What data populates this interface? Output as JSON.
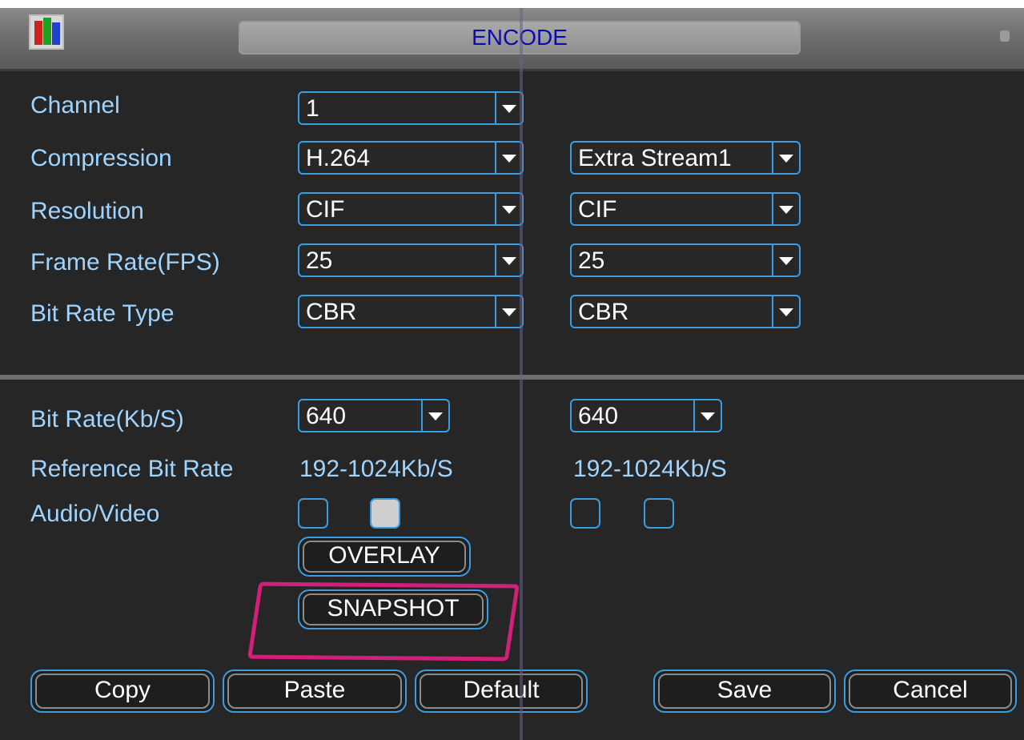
{
  "title": "ENCODE",
  "labels": {
    "channel": "Channel",
    "compression": "Compression",
    "resolution": "Resolution",
    "frame_rate": "Frame Rate(FPS)",
    "bit_rate_type": "Bit Rate Type",
    "bit_rate": "Bit Rate(Kb/S)",
    "reference_bit_rate": "Reference Bit Rate",
    "audio_video": "Audio/Video"
  },
  "main_stream": {
    "channel": "1",
    "compression": "H.264",
    "resolution": "CIF",
    "frame_rate": "25",
    "bit_rate_type": "CBR",
    "bit_rate": "640",
    "reference_bit_rate": "192-1024Kb/S",
    "audio_checked": false,
    "video_checked": true
  },
  "extra_stream": {
    "stream_select": "Extra Stream1",
    "resolution": "CIF",
    "frame_rate": "25",
    "bit_rate_type": "CBR",
    "bit_rate": "640",
    "reference_bit_rate": "192-1024Kb/S",
    "audio_checked": false,
    "video_checked": false
  },
  "buttons": {
    "overlay": "OVERLAY",
    "snapshot": "SNAPSHOT",
    "copy": "Copy",
    "paste": "Paste",
    "default": "Default",
    "save": "Save",
    "cancel": "Cancel"
  },
  "colors": {
    "title_text": "#0b0bb0",
    "label_text": "#9fd4ff",
    "control_border": "#3b9de0",
    "highlight_annotation": "#d0207a"
  }
}
